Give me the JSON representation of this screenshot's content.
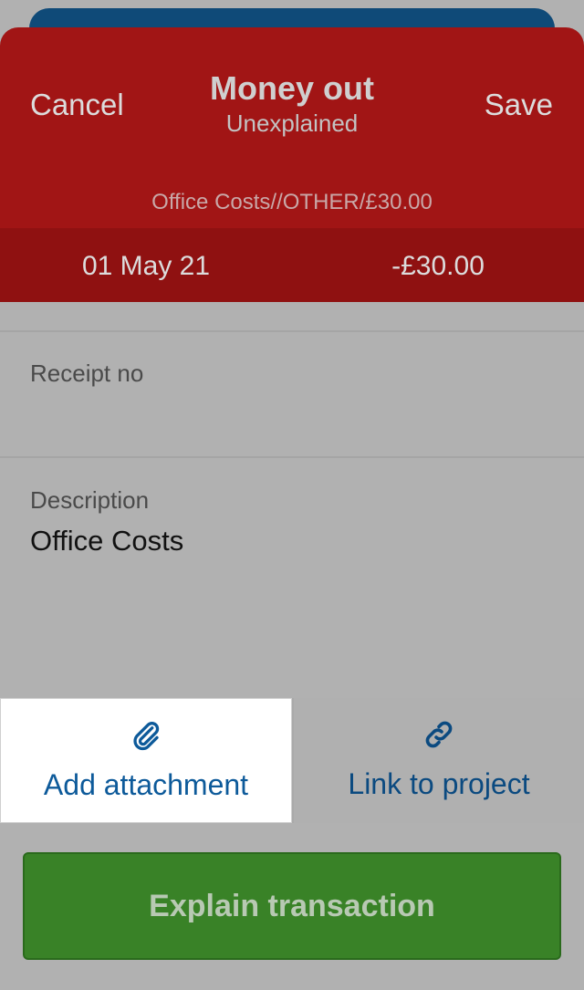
{
  "header": {
    "cancel_label": "Cancel",
    "title": "Money out",
    "subtitle": "Unexplained",
    "save_label": "Save",
    "reference": "Office Costs//OTHER/£30.00"
  },
  "summary": {
    "date": "01 May 21",
    "amount": "-£30.00"
  },
  "form": {
    "receipt_label": "Receipt no",
    "receipt_value": "",
    "description_label": "Description",
    "description_value": "Office Costs"
  },
  "actions": {
    "attachment_label": "Add attachment",
    "link_label": "Link to project"
  },
  "explain_button_label": "Explain transaction",
  "icons": {
    "attachment": "paperclip-icon",
    "link": "link-icon"
  },
  "colors": {
    "header": "#a11515",
    "summary_bar": "#8f1111",
    "primary_button": "#398227",
    "link_text": "#0d5a9a"
  }
}
